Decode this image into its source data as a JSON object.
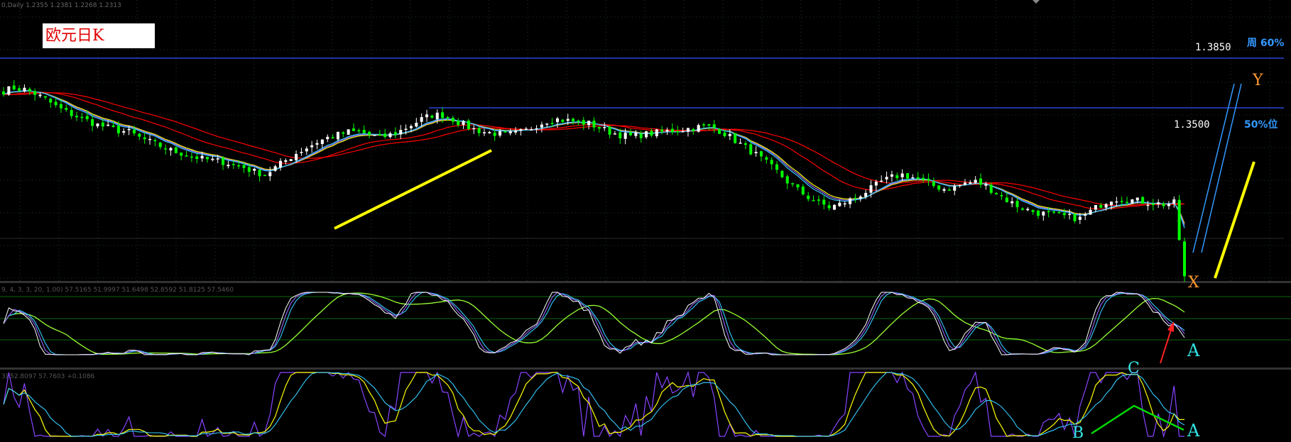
{
  "header": {
    "main_info": "0,Daily  1.2355 1.2381 1.2268 1.2313",
    "osc1_info": "9, 4, 3, 3, 20, 1.00) 57.5165 51.9997 51.6498 52.8592 51.8125 57.5460",
    "osc2_info": "3) 52.8097 57.7603 +0.1086"
  },
  "title": "欧元日K",
  "levels": [
    {
      "price": "1.3850",
      "label": "周 60%"
    },
    {
      "price": "1.3500",
      "label": "50%位"
    }
  ],
  "wave_labels": {
    "x": "X",
    "y": "Y",
    "a1": "A",
    "c": "C",
    "b": "B",
    "a2": "A"
  },
  "colors": {
    "background": "#000000",
    "bull": "#ffffff",
    "bear": "#00ff00",
    "ma_red": "#ff0000",
    "ma_yellow": "#ffff00",
    "ma_violet": "#9966ff",
    "ma_cyan": "#33ccff",
    "level_line": "#3355ff",
    "grid": "#1e3a1e",
    "trend_yellow": "#ffff00",
    "trend_blue": "#3399ff",
    "arrow_red": "#ff2222",
    "pattern_green": "#00dd00"
  },
  "chart_data": {
    "type": "candlestick",
    "timeframe": "Daily",
    "levels": [
      1.385,
      1.35
    ],
    "close_path": [
      1.362,
      1.364,
      1.363,
      1.36,
      1.356,
      1.351,
      1.347,
      1.344,
      1.341,
      1.338,
      1.336,
      1.334,
      1.333,
      1.329,
      1.326,
      1.323,
      1.32,
      1.318,
      1.316,
      1.314,
      1.313,
      1.312,
      1.31,
      1.308,
      1.305,
      1.303,
      1.308,
      1.313,
      1.318,
      1.322,
      1.326,
      1.329,
      1.331,
      1.333,
      1.333,
      1.331,
      1.329,
      1.331,
      1.334,
      1.338,
      1.342,
      1.345,
      1.345,
      1.342,
      1.338,
      1.335,
      1.333,
      1.332,
      1.331,
      1.332,
      1.334,
      1.338,
      1.341,
      1.342,
      1.341,
      1.34,
      1.339,
      1.336,
      1.333,
      1.331,
      1.33,
      1.331,
      1.332,
      1.333,
      1.334,
      1.335,
      1.336,
      1.337,
      1.336,
      1.332,
      1.327,
      1.322,
      1.317,
      1.311,
      1.305,
      1.298,
      1.292,
      1.287,
      1.283,
      1.28,
      1.282,
      1.285,
      1.289,
      1.293,
      1.298,
      1.301,
      1.303,
      1.301,
      1.298,
      1.295,
      1.293,
      1.294,
      1.297,
      1.298,
      1.295,
      1.29,
      1.285,
      1.281,
      1.278,
      1.276,
      1.275,
      1.274,
      1.273,
      1.272,
      1.277,
      1.282,
      1.286,
      1.286,
      1.285,
      1.284,
      1.283,
      1.282,
      1.283,
      1.2313
    ]
  }
}
